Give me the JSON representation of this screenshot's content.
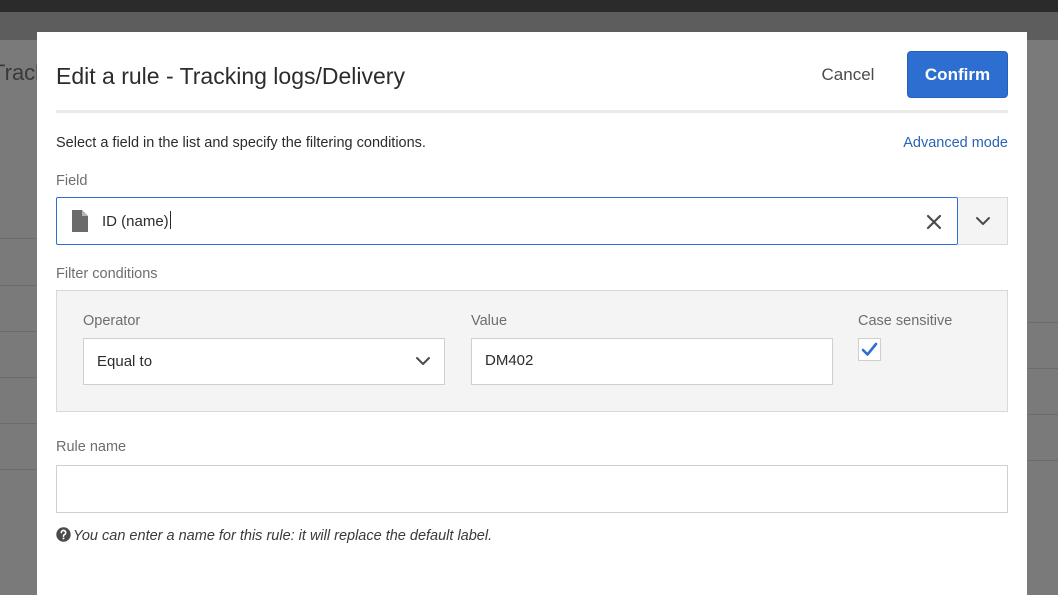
{
  "background": {
    "page_title_fragment": "Tracki"
  },
  "dialog": {
    "title": "Edit a rule - Tracking logs/Delivery",
    "cancel_label": "Cancel",
    "confirm_label": "Confirm",
    "instructions": "Select a field in the list and specify the filtering conditions.",
    "advanced_mode_label": "Advanced mode",
    "field": {
      "label": "Field",
      "value": "ID (name)",
      "icon": "file-icon"
    },
    "filter_conditions": {
      "label": "Filter conditions",
      "operator_label": "Operator",
      "operator_value": "Equal to",
      "value_label": "Value",
      "value": "DM402",
      "case_sensitive_label": "Case sensitive",
      "case_sensitive_checked": true
    },
    "rule_name": {
      "label": "Rule name",
      "value": "",
      "help_text": "You can enter a name for this rule: it will replace the default label."
    }
  },
  "colors": {
    "accent": "#2d6fd0",
    "link": "#2a64b6",
    "overlay": "#7a7a7a"
  }
}
